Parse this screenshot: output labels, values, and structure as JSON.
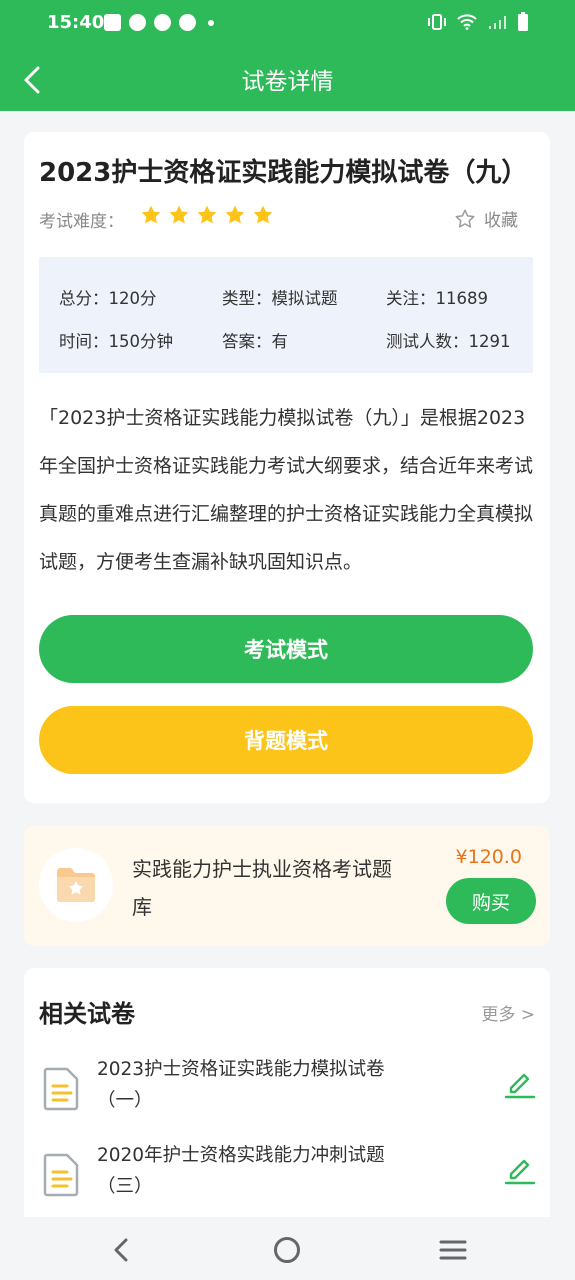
{
  "status_bar": {
    "time": "15:40"
  },
  "header": {
    "title": "试卷详情"
  },
  "exam": {
    "title": "2023护士资格证实践能力模拟试卷（九）",
    "difficulty_label": "考试难度：",
    "difficulty_stars": 5,
    "favorite_label": "收藏",
    "info": {
      "total_score": "总分：120分",
      "type": "类型：模拟试题",
      "follows": "关注：11689",
      "time": "时间：150分钟",
      "answer": "答案：有",
      "testers": "测试人数：1291"
    },
    "description": "「2023护士资格证实践能力模拟试卷（九）」是根据2023年全国护士资格证实践能力考试大纲要求，结合近年来考试真题的重难点进行汇编整理的护士资格证实践能力全真模拟试题，方便考生查漏补缺巩固知识点。",
    "exam_mode_label": "考试模式",
    "recite_mode_label": "背题模式"
  },
  "product": {
    "name": "实践能力护士执业资格考试题库",
    "price": "¥120.0",
    "buy_label": "购买",
    "icon": "folder-star-icon"
  },
  "related": {
    "title": "相关试卷",
    "more_label": "更多 >",
    "items": [
      {
        "label": "2023护士资格证实践能力模拟试卷（一）"
      },
      {
        "label": "2020年护士资格实践能力冲刺试题（三）"
      }
    ]
  },
  "colors": {
    "primary": "#2fba5a",
    "accent_yellow": "#fcc419",
    "price_orange": "#e8751a",
    "info_bg": "#eef3fb"
  }
}
